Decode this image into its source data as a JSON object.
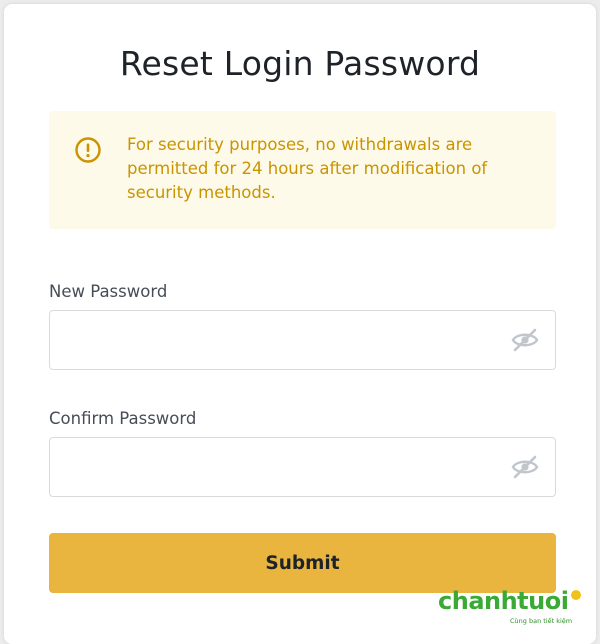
{
  "page": {
    "title": "Reset Login Password"
  },
  "notice": {
    "icon": "alert-circle-icon",
    "text": "For security purposes, no withdrawals are permitted for 24 hours after modification of security methods.",
    "color": "#c99400",
    "background": "#fefaea"
  },
  "new_password": {
    "label": "New Password",
    "value": "",
    "icon": "eye-off-icon"
  },
  "confirm_password": {
    "label": "Confirm Password",
    "value": "",
    "icon": "eye-off-icon"
  },
  "submit": {
    "label": "Submit",
    "color": "#e9b53f"
  },
  "watermark": {
    "brand": "chanhtuoi",
    "tagline": "Cùng bạn tiết kiệm"
  }
}
